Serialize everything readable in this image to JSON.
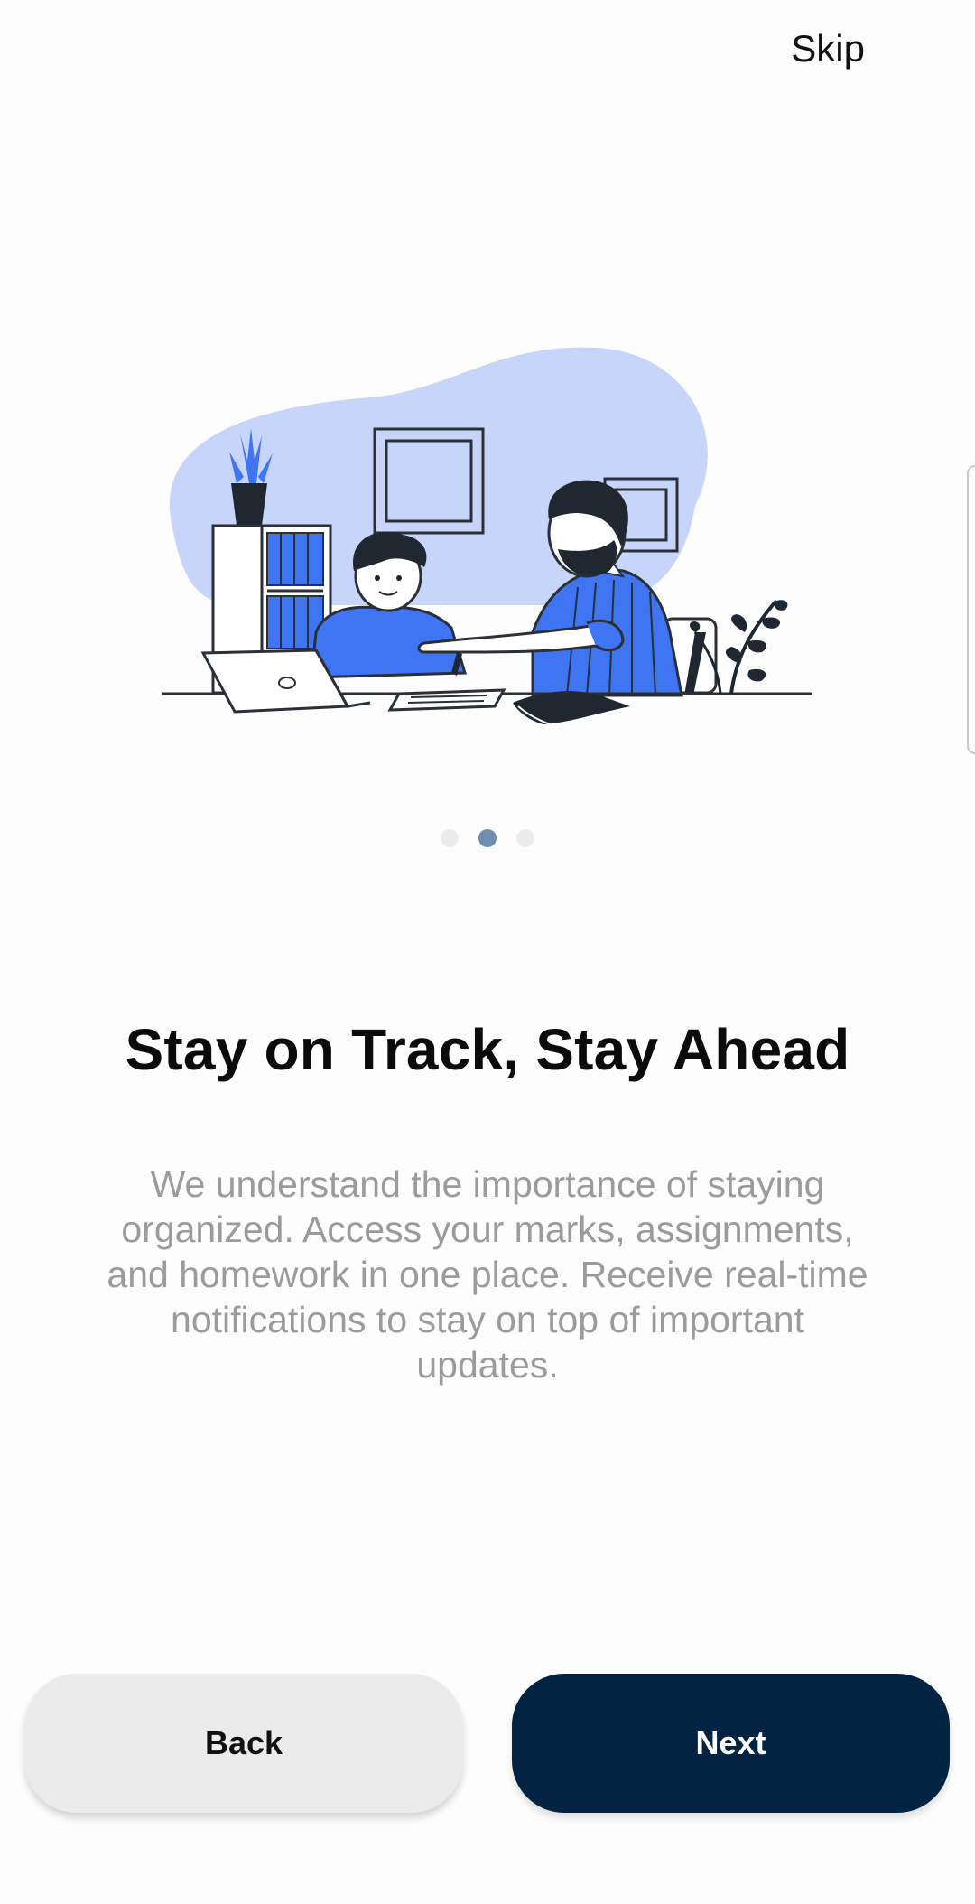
{
  "header": {
    "skip_label": "Skip"
  },
  "illustration": {
    "name": "tutor-helping-student-illustration"
  },
  "pager": {
    "total_pages": 3,
    "current_page": 2
  },
  "content": {
    "title": "Stay on Track, Stay Ahead",
    "description": "We understand the importance of staying organized. Access your marks, assignments, and homework in one place. Receive real-time notifications to stay on top of important updates."
  },
  "actions": {
    "back_label": "Back",
    "next_label": "Next"
  },
  "colors": {
    "primary": "#022442",
    "accent_blue": "#3f74f2",
    "blob": "#c7d5fb",
    "dot_active": "#6f8fb2",
    "dot_inactive": "#ececec",
    "secondary_button": "#ebebeb",
    "description_text": "#9b9b9b"
  }
}
